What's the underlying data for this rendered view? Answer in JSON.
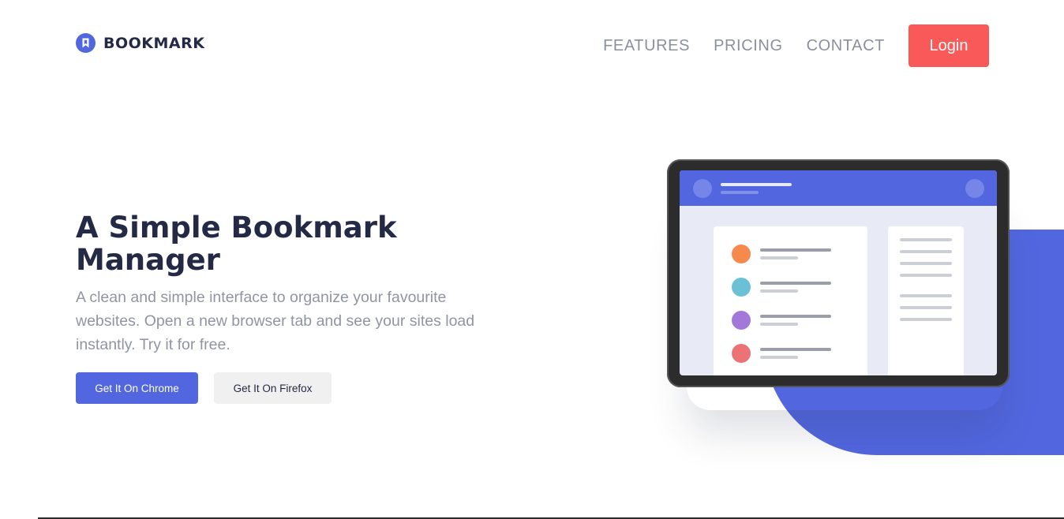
{
  "brand": {
    "name": "BOOKMARK",
    "icon": "bookmark-icon",
    "color": "#5267DF"
  },
  "nav": {
    "items": [
      {
        "label": "FEATURES"
      },
      {
        "label": "PRICING"
      },
      {
        "label": "CONTACT"
      }
    ],
    "login_label": "Login"
  },
  "hero": {
    "title": "A Simple Bookmark Manager",
    "description": "A clean and simple interface to organize your favourite websites. Open a new browser tab and see your sites load instantly. Try it for free.",
    "chrome_button": "Get It On Chrome",
    "firefox_button": "Get It On Firefox"
  },
  "colors": {
    "accent": "#5267DF",
    "login": "#FA5959",
    "heading": "#242A45",
    "muted": "#9194A2",
    "bookmark_dots": [
      "#F8894C",
      "#6AC1D6",
      "#A279D8",
      "#EC7275"
    ]
  }
}
